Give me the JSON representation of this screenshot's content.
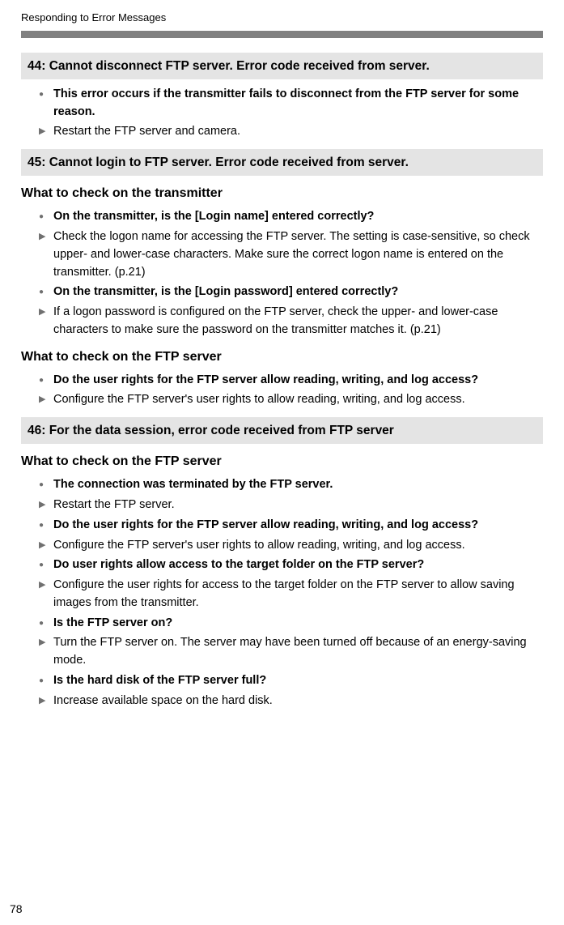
{
  "runningHead": "Responding to Error Messages",
  "pageNumber": "78",
  "sections": [
    {
      "title": "44:  Cannot disconnect FTP server. Error code received from server.",
      "groups": [
        {
          "heading": null,
          "items": [
            {
              "type": "bullet",
              "text": "This error occurs if the transmitter fails to disconnect from the FTP server for some reason."
            },
            {
              "type": "action",
              "text": "Restart the FTP server and camera."
            }
          ]
        }
      ]
    },
    {
      "title": "45:  Cannot login to FTP server. Error code received from server.",
      "groups": [
        {
          "heading": "What to check on the transmitter",
          "items": [
            {
              "type": "bullet",
              "text": "On the transmitter, is the [Login name] entered correctly?"
            },
            {
              "type": "action",
              "text": "Check the logon name for accessing the FTP server. The setting is case-sensitive, so check upper- and lower-case characters. Make sure the correct logon name is entered on the transmitter. (p.21)"
            },
            {
              "type": "bullet",
              "text": "On the transmitter, is the [Login password] entered correctly?"
            },
            {
              "type": "action",
              "text": "If a logon password is configured on the FTP server, check the upper- and lower-case characters to make sure the password on the transmitter matches it. (p.21)"
            }
          ]
        },
        {
          "heading": "What to check on the FTP server",
          "items": [
            {
              "type": "bullet",
              "text": "Do the user rights for the FTP server allow reading, writing, and log access?"
            },
            {
              "type": "action",
              "text": "Configure the FTP server's user rights to allow reading, writing, and log access."
            }
          ]
        }
      ]
    },
    {
      "title": "46:  For the data session, error code received from FTP server",
      "groups": [
        {
          "heading": "What to check on the FTP server",
          "items": [
            {
              "type": "bullet",
              "text": "The connection was terminated by the FTP server."
            },
            {
              "type": "action",
              "text": "Restart the FTP server."
            },
            {
              "type": "bullet",
              "text": "Do the user rights for the FTP server allow reading, writing, and log access?"
            },
            {
              "type": "action",
              "text": "Configure the FTP server's user rights to allow reading, writing, and log access."
            },
            {
              "type": "bullet",
              "text": "Do user rights allow access to the target folder on the FTP server?"
            },
            {
              "type": "action",
              "text": "Configure the user rights for access to the target folder on the FTP server to allow saving images from the transmitter."
            },
            {
              "type": "bullet",
              "text": "Is the FTP server on?"
            },
            {
              "type": "action",
              "text": "Turn the FTP server on. The server may have been turned off because of an energy-saving mode."
            },
            {
              "type": "bullet",
              "text": "Is the hard disk of the FTP server full?"
            },
            {
              "type": "action",
              "text": "Increase available space on the hard disk."
            }
          ]
        }
      ]
    }
  ]
}
